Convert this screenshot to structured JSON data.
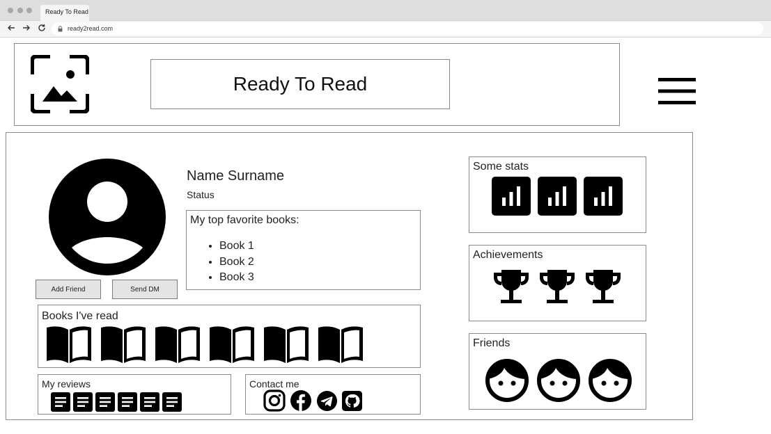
{
  "browser": {
    "tab_title": "Ready To Read",
    "url": "ready2read.com"
  },
  "header": {
    "logo_icon": "image-placeholder-icon",
    "title": "Ready To Read",
    "menu_icon": "hamburger-menu-icon"
  },
  "profile": {
    "avatar_icon": "account-circle-icon",
    "name": "Name Surname",
    "status": "Status",
    "add_friend_label": "Add Friend",
    "send_dm_label": "Send DM"
  },
  "favorites": {
    "title": "My top favorite books:",
    "books": [
      "Book 1",
      "Book 2",
      "Book 3"
    ]
  },
  "books_read": {
    "title": "Books I've read",
    "count": 6,
    "icon": "open-book-icon"
  },
  "reviews": {
    "title": "My reviews",
    "count": 6,
    "icon": "article-icon"
  },
  "contact": {
    "title": "Contact me",
    "icons": [
      "instagram-icon",
      "facebook-icon",
      "telegram-icon",
      "github-icon"
    ]
  },
  "stats": {
    "title": "Some stats",
    "count": 3,
    "icon": "bar-chart-icon"
  },
  "achievements": {
    "title": "Achievements",
    "count": 3,
    "icon": "trophy-icon"
  },
  "friends": {
    "title": "Friends",
    "count": 3,
    "icon": "face-icon"
  }
}
